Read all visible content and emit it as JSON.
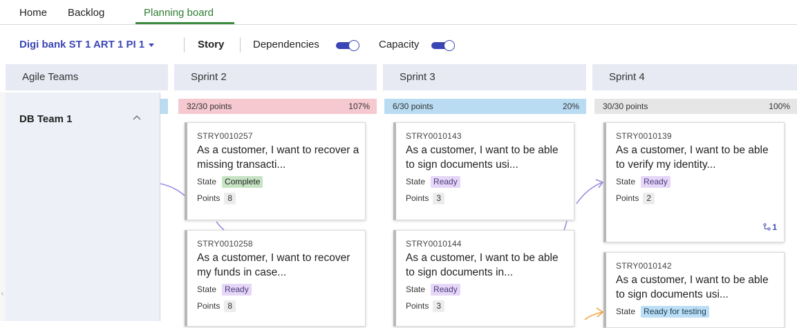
{
  "nav": {
    "tabs": [
      {
        "label": "Home"
      },
      {
        "label": "Backlog"
      },
      {
        "label": "Planning board"
      }
    ]
  },
  "toolbar": {
    "selector": "Digi bank ST 1 ART 1 PI 1",
    "story": "Story",
    "dependencies": "Dependencies",
    "capacity": "Capacity"
  },
  "columns": {
    "teams": "Agile Teams",
    "sprints": [
      {
        "name": "Sprint 2",
        "points": "32/30 points",
        "pct": "107%",
        "color": "#f5c9cf"
      },
      {
        "name": "Sprint 3",
        "points": "6/30 points",
        "pct": "20%",
        "color": "#b9dcf3"
      },
      {
        "name": "Sprint 4",
        "points": "30/30 points",
        "pct": "100%",
        "color": "#e6e6e6"
      }
    ]
  },
  "team": {
    "name": "DB Team 1"
  },
  "labels": {
    "state": "State",
    "points": "Points"
  },
  "cards": [
    {
      "id": "STRY0010257",
      "title": "As a customer, I want to recover a missing transacti...",
      "state": "Complete",
      "points": "8"
    },
    {
      "id": "STRY0010258",
      "title": "As a customer, I want to recover my funds in case...",
      "state": "Ready",
      "points": "8"
    },
    {
      "id": "STRY0010143",
      "title": "As a customer, I want to be able to sign documents usi...",
      "state": "Ready",
      "points": "3"
    },
    {
      "id": "STRY0010144",
      "title": "As a customer, I want to be able to sign documents in...",
      "state": "Ready",
      "points": "3"
    },
    {
      "id": "STRY0010139",
      "title": "As a customer, I want to be able to verify my identity...",
      "state": "Ready",
      "points": "2",
      "dependencies": "1"
    },
    {
      "id": "STRY0010142",
      "title": "As a customer, I want to be able to sign documents usi...",
      "state": "Ready for testing"
    }
  ],
  "colors": {
    "accent": "#3b46b5",
    "active_tab": "#2e7d32",
    "link_purple": "#9a8ee0",
    "link_orange": "#f2a33a"
  }
}
